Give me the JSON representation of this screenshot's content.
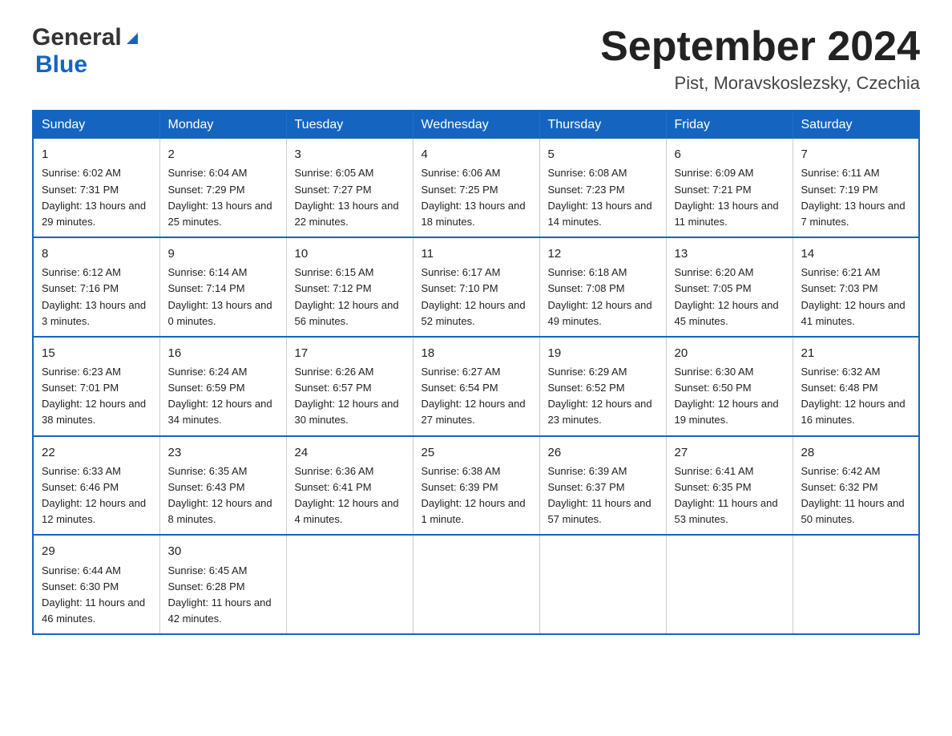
{
  "header": {
    "logo_general": "General",
    "logo_blue": "Blue",
    "month_title": "September 2024",
    "location": "Pist, Moravskoslezsky, Czechia"
  },
  "days": [
    "Sunday",
    "Monday",
    "Tuesday",
    "Wednesday",
    "Thursday",
    "Friday",
    "Saturday"
  ],
  "weeks": [
    [
      {
        "day": "1",
        "sunrise": "Sunrise: 6:02 AM",
        "sunset": "Sunset: 7:31 PM",
        "daylight": "Daylight: 13 hours and 29 minutes."
      },
      {
        "day": "2",
        "sunrise": "Sunrise: 6:04 AM",
        "sunset": "Sunset: 7:29 PM",
        "daylight": "Daylight: 13 hours and 25 minutes."
      },
      {
        "day": "3",
        "sunrise": "Sunrise: 6:05 AM",
        "sunset": "Sunset: 7:27 PM",
        "daylight": "Daylight: 13 hours and 22 minutes."
      },
      {
        "day": "4",
        "sunrise": "Sunrise: 6:06 AM",
        "sunset": "Sunset: 7:25 PM",
        "daylight": "Daylight: 13 hours and 18 minutes."
      },
      {
        "day": "5",
        "sunrise": "Sunrise: 6:08 AM",
        "sunset": "Sunset: 7:23 PM",
        "daylight": "Daylight: 13 hours and 14 minutes."
      },
      {
        "day": "6",
        "sunrise": "Sunrise: 6:09 AM",
        "sunset": "Sunset: 7:21 PM",
        "daylight": "Daylight: 13 hours and 11 minutes."
      },
      {
        "day": "7",
        "sunrise": "Sunrise: 6:11 AM",
        "sunset": "Sunset: 7:19 PM",
        "daylight": "Daylight: 13 hours and 7 minutes."
      }
    ],
    [
      {
        "day": "8",
        "sunrise": "Sunrise: 6:12 AM",
        "sunset": "Sunset: 7:16 PM",
        "daylight": "Daylight: 13 hours and 3 minutes."
      },
      {
        "day": "9",
        "sunrise": "Sunrise: 6:14 AM",
        "sunset": "Sunset: 7:14 PM",
        "daylight": "Daylight: 13 hours and 0 minutes."
      },
      {
        "day": "10",
        "sunrise": "Sunrise: 6:15 AM",
        "sunset": "Sunset: 7:12 PM",
        "daylight": "Daylight: 12 hours and 56 minutes."
      },
      {
        "day": "11",
        "sunrise": "Sunrise: 6:17 AM",
        "sunset": "Sunset: 7:10 PM",
        "daylight": "Daylight: 12 hours and 52 minutes."
      },
      {
        "day": "12",
        "sunrise": "Sunrise: 6:18 AM",
        "sunset": "Sunset: 7:08 PM",
        "daylight": "Daylight: 12 hours and 49 minutes."
      },
      {
        "day": "13",
        "sunrise": "Sunrise: 6:20 AM",
        "sunset": "Sunset: 7:05 PM",
        "daylight": "Daylight: 12 hours and 45 minutes."
      },
      {
        "day": "14",
        "sunrise": "Sunrise: 6:21 AM",
        "sunset": "Sunset: 7:03 PM",
        "daylight": "Daylight: 12 hours and 41 minutes."
      }
    ],
    [
      {
        "day": "15",
        "sunrise": "Sunrise: 6:23 AM",
        "sunset": "Sunset: 7:01 PM",
        "daylight": "Daylight: 12 hours and 38 minutes."
      },
      {
        "day": "16",
        "sunrise": "Sunrise: 6:24 AM",
        "sunset": "Sunset: 6:59 PM",
        "daylight": "Daylight: 12 hours and 34 minutes."
      },
      {
        "day": "17",
        "sunrise": "Sunrise: 6:26 AM",
        "sunset": "Sunset: 6:57 PM",
        "daylight": "Daylight: 12 hours and 30 minutes."
      },
      {
        "day": "18",
        "sunrise": "Sunrise: 6:27 AM",
        "sunset": "Sunset: 6:54 PM",
        "daylight": "Daylight: 12 hours and 27 minutes."
      },
      {
        "day": "19",
        "sunrise": "Sunrise: 6:29 AM",
        "sunset": "Sunset: 6:52 PM",
        "daylight": "Daylight: 12 hours and 23 minutes."
      },
      {
        "day": "20",
        "sunrise": "Sunrise: 6:30 AM",
        "sunset": "Sunset: 6:50 PM",
        "daylight": "Daylight: 12 hours and 19 minutes."
      },
      {
        "day": "21",
        "sunrise": "Sunrise: 6:32 AM",
        "sunset": "Sunset: 6:48 PM",
        "daylight": "Daylight: 12 hours and 16 minutes."
      }
    ],
    [
      {
        "day": "22",
        "sunrise": "Sunrise: 6:33 AM",
        "sunset": "Sunset: 6:46 PM",
        "daylight": "Daylight: 12 hours and 12 minutes."
      },
      {
        "day": "23",
        "sunrise": "Sunrise: 6:35 AM",
        "sunset": "Sunset: 6:43 PM",
        "daylight": "Daylight: 12 hours and 8 minutes."
      },
      {
        "day": "24",
        "sunrise": "Sunrise: 6:36 AM",
        "sunset": "Sunset: 6:41 PM",
        "daylight": "Daylight: 12 hours and 4 minutes."
      },
      {
        "day": "25",
        "sunrise": "Sunrise: 6:38 AM",
        "sunset": "Sunset: 6:39 PM",
        "daylight": "Daylight: 12 hours and 1 minute."
      },
      {
        "day": "26",
        "sunrise": "Sunrise: 6:39 AM",
        "sunset": "Sunset: 6:37 PM",
        "daylight": "Daylight: 11 hours and 57 minutes."
      },
      {
        "day": "27",
        "sunrise": "Sunrise: 6:41 AM",
        "sunset": "Sunset: 6:35 PM",
        "daylight": "Daylight: 11 hours and 53 minutes."
      },
      {
        "day": "28",
        "sunrise": "Sunrise: 6:42 AM",
        "sunset": "Sunset: 6:32 PM",
        "daylight": "Daylight: 11 hours and 50 minutes."
      }
    ],
    [
      {
        "day": "29",
        "sunrise": "Sunrise: 6:44 AM",
        "sunset": "Sunset: 6:30 PM",
        "daylight": "Daylight: 11 hours and 46 minutes."
      },
      {
        "day": "30",
        "sunrise": "Sunrise: 6:45 AM",
        "sunset": "Sunset: 6:28 PM",
        "daylight": "Daylight: 11 hours and 42 minutes."
      },
      {
        "day": "",
        "sunrise": "",
        "sunset": "",
        "daylight": ""
      },
      {
        "day": "",
        "sunrise": "",
        "sunset": "",
        "daylight": ""
      },
      {
        "day": "",
        "sunrise": "",
        "sunset": "",
        "daylight": ""
      },
      {
        "day": "",
        "sunrise": "",
        "sunset": "",
        "daylight": ""
      },
      {
        "day": "",
        "sunrise": "",
        "sunset": "",
        "daylight": ""
      }
    ]
  ]
}
